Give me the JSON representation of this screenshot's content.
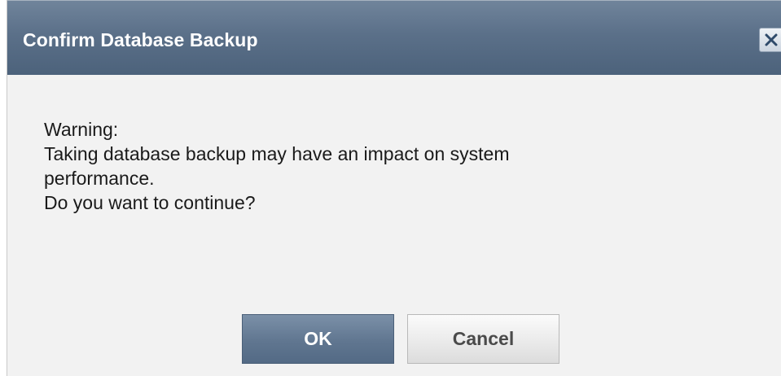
{
  "dialog": {
    "title": "Confirm Database Backup",
    "close_icon": "close-icon",
    "message_lines": [
      "Warning:",
      "Taking database backup may have an impact on system",
      "performance.",
      "Do you want to continue?"
    ],
    "ok_label": "OK",
    "cancel_label": "Cancel"
  },
  "colors": {
    "title_bar": "#5b7089",
    "ok_button": "#607690",
    "cancel_button": "#e9e9e9",
    "dialog_background": "#f2f2f2"
  }
}
